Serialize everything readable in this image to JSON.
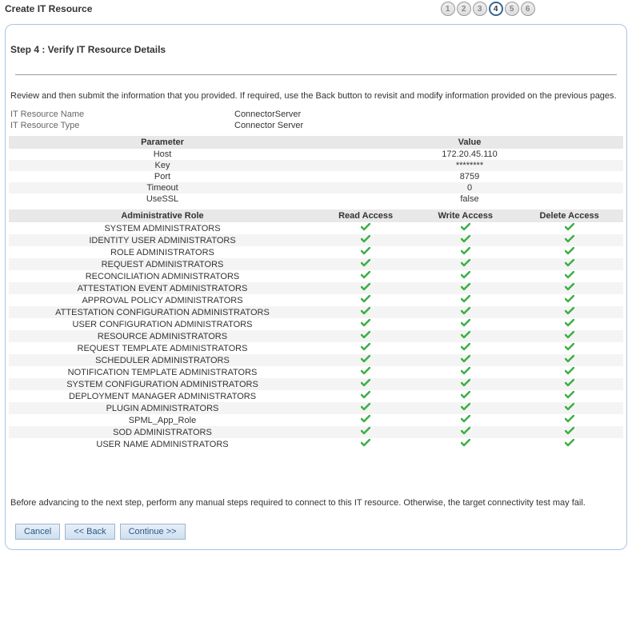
{
  "page_title": "Create IT Resource",
  "steps": [
    {
      "num": "1",
      "current": false
    },
    {
      "num": "2",
      "current": false
    },
    {
      "num": "3",
      "current": false
    },
    {
      "num": "4",
      "current": true
    },
    {
      "num": "5",
      "current": false
    },
    {
      "num": "6",
      "current": false
    }
  ],
  "step_heading": "Step 4 : Verify IT Resource Details",
  "review_text": "Review and then submit the information that you provided. If required, use the Back button to revisit and modify information provided on the previous pages.",
  "meta": {
    "name_label": "IT Resource Name",
    "name_value": "ConnectorServer",
    "type_label": "IT Resource Type",
    "type_value": "Connector Server"
  },
  "param_headers": [
    "Parameter",
    "Value"
  ],
  "parameters": [
    {
      "name": "Host",
      "value": "172.20.45.110"
    },
    {
      "name": "Key",
      "value": "********"
    },
    {
      "name": "Port",
      "value": "8759"
    },
    {
      "name": "Timeout",
      "value": "0"
    },
    {
      "name": "UseSSL",
      "value": "false"
    }
  ],
  "role_headers": [
    "Administrative Role",
    "Read Access",
    "Write Access",
    "Delete Access"
  ],
  "roles": [
    {
      "name": "SYSTEM ADMINISTRATORS",
      "read": true,
      "write": true,
      "delete": true
    },
    {
      "name": "IDENTITY USER ADMINISTRATORS",
      "read": true,
      "write": true,
      "delete": true
    },
    {
      "name": "ROLE ADMINISTRATORS",
      "read": true,
      "write": true,
      "delete": true
    },
    {
      "name": "REQUEST ADMINISTRATORS",
      "read": true,
      "write": true,
      "delete": true
    },
    {
      "name": "RECONCILIATION ADMINISTRATORS",
      "read": true,
      "write": true,
      "delete": true
    },
    {
      "name": "ATTESTATION EVENT ADMINISTRATORS",
      "read": true,
      "write": true,
      "delete": true
    },
    {
      "name": "APPROVAL POLICY ADMINISTRATORS",
      "read": true,
      "write": true,
      "delete": true
    },
    {
      "name": "ATTESTATION CONFIGURATION ADMINISTRATORS",
      "read": true,
      "write": true,
      "delete": true
    },
    {
      "name": "USER CONFIGURATION ADMINISTRATORS",
      "read": true,
      "write": true,
      "delete": true
    },
    {
      "name": "RESOURCE ADMINISTRATORS",
      "read": true,
      "write": true,
      "delete": true
    },
    {
      "name": "REQUEST TEMPLATE ADMINISTRATORS",
      "read": true,
      "write": true,
      "delete": true
    },
    {
      "name": "SCHEDULER ADMINISTRATORS",
      "read": true,
      "write": true,
      "delete": true
    },
    {
      "name": "NOTIFICATION TEMPLATE ADMINISTRATORS",
      "read": true,
      "write": true,
      "delete": true
    },
    {
      "name": "SYSTEM CONFIGURATION ADMINISTRATORS",
      "read": true,
      "write": true,
      "delete": true
    },
    {
      "name": "DEPLOYMENT MANAGER ADMINISTRATORS",
      "read": true,
      "write": true,
      "delete": true
    },
    {
      "name": "PLUGIN ADMINISTRATORS",
      "read": true,
      "write": true,
      "delete": true
    },
    {
      "name": "SPML_App_Role",
      "read": true,
      "write": true,
      "delete": true
    },
    {
      "name": "SOD ADMINISTRATORS",
      "read": true,
      "write": true,
      "delete": true
    },
    {
      "name": "USER NAME ADMINISTRATORS",
      "read": true,
      "write": true,
      "delete": true
    }
  ],
  "footer_note": "Before advancing to the next step, perform any manual steps required to connect to this IT resource. Otherwise, the target connectivity test may fail.",
  "buttons": {
    "cancel": "Cancel",
    "back": "<< Back",
    "continue": "Continue >>"
  }
}
